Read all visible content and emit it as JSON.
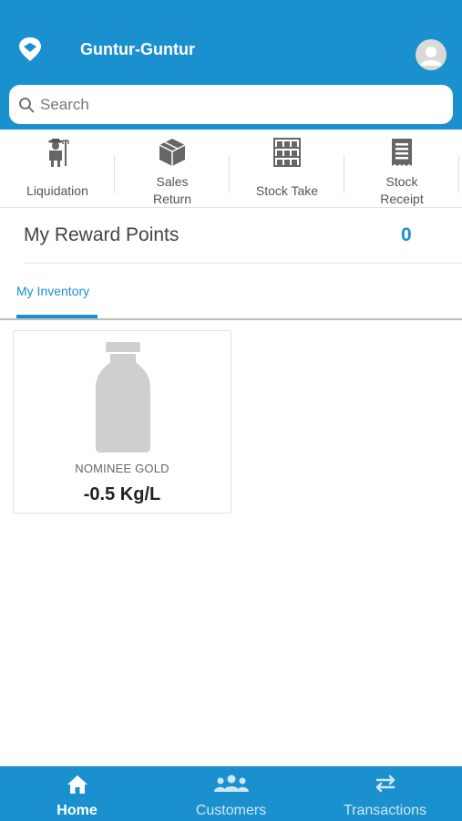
{
  "header": {
    "location": "Guntur-Guntur",
    "search_placeholder": "Search"
  },
  "actions": [
    {
      "label": "Liquidation",
      "icon": "farmer-icon"
    },
    {
      "label": "Sales\nReturn",
      "icon": "package-icon"
    },
    {
      "label": "Stock Take",
      "icon": "shelves-icon"
    },
    {
      "label": "Stock\nReceipt",
      "icon": "receipt-icon"
    }
  ],
  "rewards": {
    "label": "My Reward Points",
    "value": "0"
  },
  "tabs": {
    "active": "My Inventory"
  },
  "inventory": [
    {
      "name": "NOMINEE GOLD",
      "quantity": "-0.5 Kg/L",
      "icon": "bottle-icon"
    }
  ],
  "bottom_nav": [
    {
      "label": "Home",
      "icon": "home-icon",
      "active": true
    },
    {
      "label": "Customers",
      "icon": "customers-icon",
      "active": false
    },
    {
      "label": "Transactions",
      "icon": "transactions-icon",
      "active": false
    }
  ],
  "colors": {
    "primary": "#1a90cf",
    "text": "#333333"
  }
}
